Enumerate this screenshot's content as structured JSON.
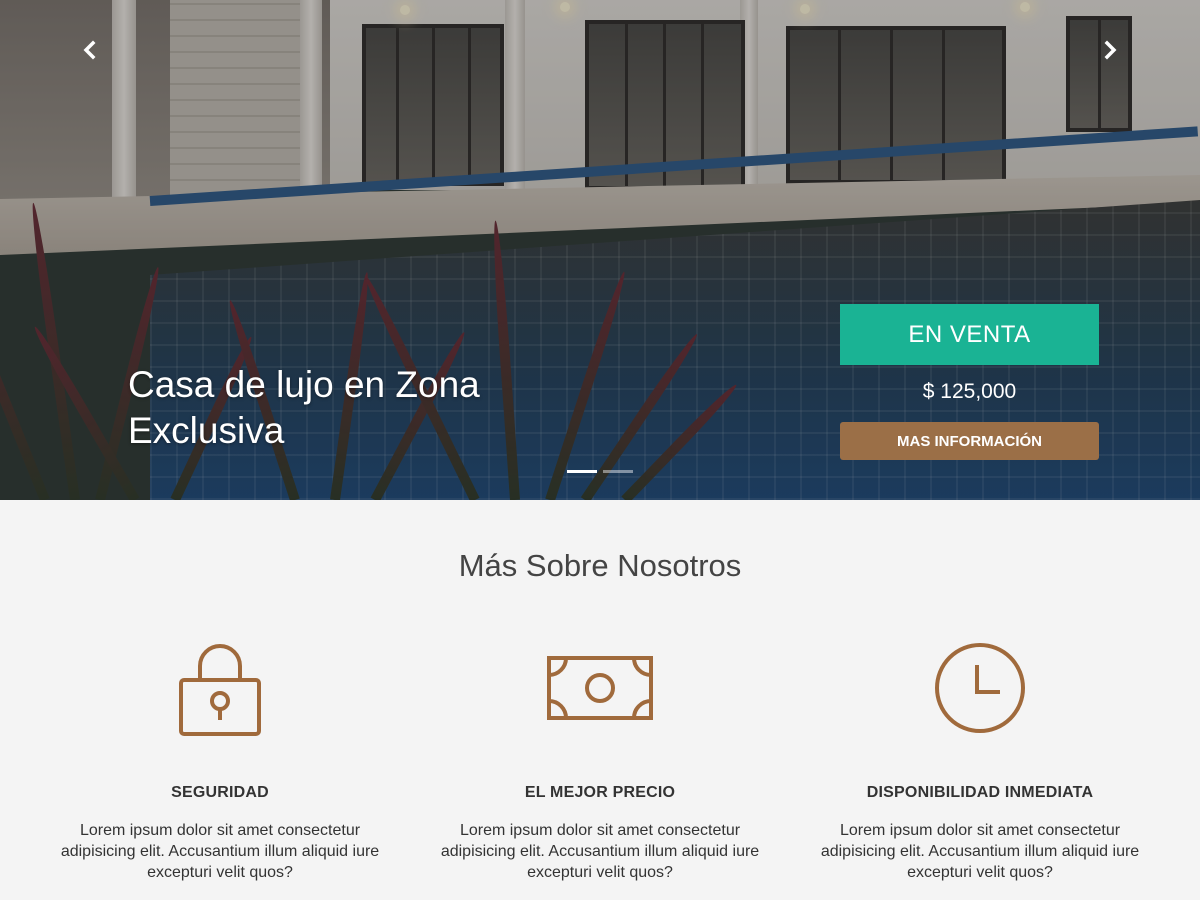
{
  "hero": {
    "prev_icon": "chevron-left-icon",
    "next_icon": "chevron-right-icon",
    "title": "Casa de lujo en Zona Exclusiva",
    "badge": "EN VENTA",
    "price": "$ 125,000",
    "button": "MAS INFORMACIÓN",
    "indicators": 2,
    "active_indicator": 0
  },
  "about": {
    "title": "Más Sobre Nosotros",
    "features": [
      {
        "icon": "lock-icon",
        "title": "SEGURIDAD",
        "text": "Lorem ipsum dolor sit amet consectetur adipisicing elit. Accusantium illum aliquid iure excepturi velit quos?"
      },
      {
        "icon": "money-bill-icon",
        "title": "EL MEJOR PRECIO",
        "text": "Lorem ipsum dolor sit amet consectetur adipisicing elit. Accusantium illum aliquid iure excepturi velit quos?"
      },
      {
        "icon": "clock-icon",
        "title": "DISPONIBILIDAD INMEDIATA",
        "text": "Lorem ipsum dolor sit amet consectetur adipisicing elit. Accusantium illum aliquid iure excepturi velit quos?"
      }
    ]
  },
  "colors": {
    "badge": "#1ab394",
    "button": "#9b6f47",
    "icon": "#a06a3c"
  }
}
